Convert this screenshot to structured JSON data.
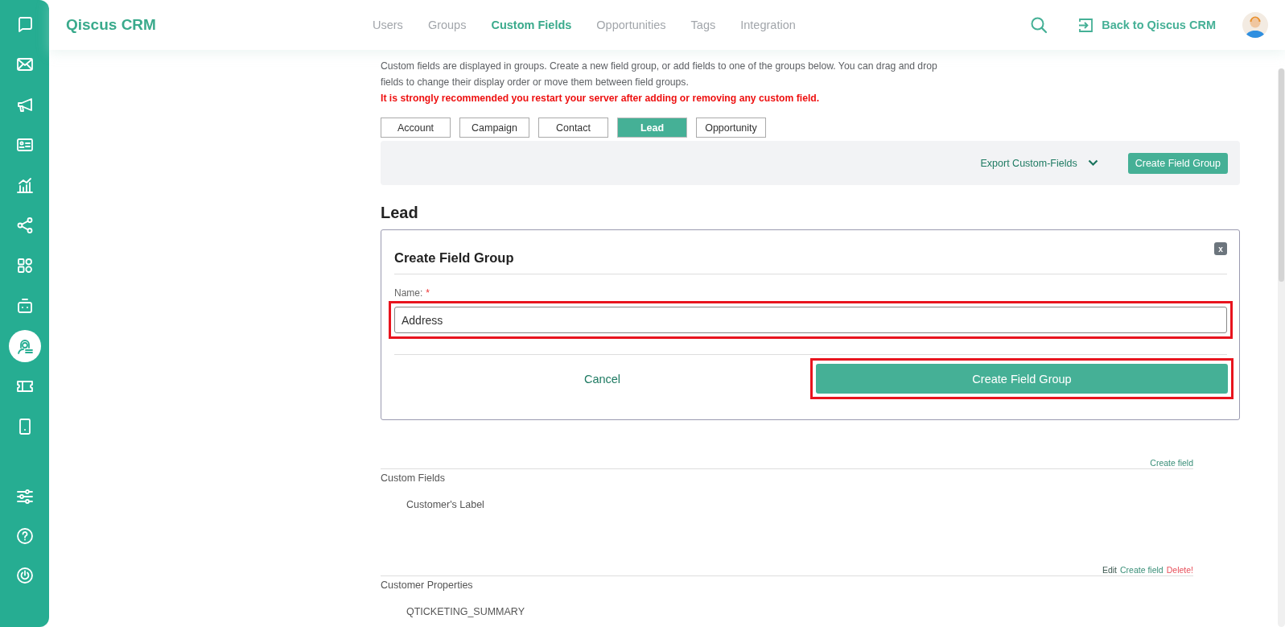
{
  "sidebar": {
    "top_items": [
      {
        "selected": false
      },
      {
        "selected": false
      },
      {
        "selected": false
      },
      {
        "selected": false
      },
      {
        "selected": false
      },
      {
        "selected": false
      },
      {
        "selected": false
      },
      {
        "selected": false
      },
      {
        "selected": true
      },
      {
        "selected": false
      },
      {
        "selected": false
      }
    ],
    "bottom_items": [
      {
        "selected": false
      },
      {
        "selected": false
      },
      {
        "selected": false
      }
    ]
  },
  "header": {
    "logo": "Qiscus CRM",
    "nav": [
      {
        "label": "Users",
        "selected": false
      },
      {
        "label": "Groups",
        "selected": false
      },
      {
        "label": "Custom Fields",
        "selected": true
      },
      {
        "label": "Opportunities",
        "selected": false
      },
      {
        "label": "Tags",
        "selected": false
      },
      {
        "label": "Integration",
        "selected": false
      }
    ],
    "back_link": "Back to Qiscus CRM"
  },
  "intro": "Custom fields are displayed in groups. Create a new field group, or add fields to one of the groups below. You can drag and drop fields to change their display order or move them between field groups.",
  "warning": "It is strongly recommended you restart your server after adding or removing any custom field.",
  "tabs": [
    {
      "label": "Account",
      "selected": false
    },
    {
      "label": "Campaign",
      "selected": false
    },
    {
      "label": "Contact",
      "selected": false
    },
    {
      "label": "Lead",
      "selected": true
    },
    {
      "label": "Opportunity",
      "selected": false
    }
  ],
  "toolbar": {
    "export": "Export Custom-Fields",
    "create": "Create Field Group"
  },
  "heading": "Lead",
  "dialog": {
    "title": "Create Field Group",
    "close": "x",
    "name_label": "Name:",
    "required_mark": "*",
    "name_value": "Address",
    "name_highlighted": true,
    "cancel": "Cancel",
    "submit": "Create Field Group",
    "submit_highlighted": true
  },
  "groups": [
    {
      "title": "Custom Fields",
      "actions": [
        {
          "label": "Create field",
          "kind": "create"
        }
      ],
      "fields": [
        "Customer's Label"
      ]
    },
    {
      "title": "Customer Properties",
      "actions": [
        {
          "label": "Edit",
          "kind": "edit"
        },
        {
          "label": "Create field",
          "kind": "create"
        },
        {
          "label": "Delete!",
          "kind": "delete"
        }
      ],
      "fields": [
        "QTICKETING_SUMMARY"
      ]
    }
  ]
}
